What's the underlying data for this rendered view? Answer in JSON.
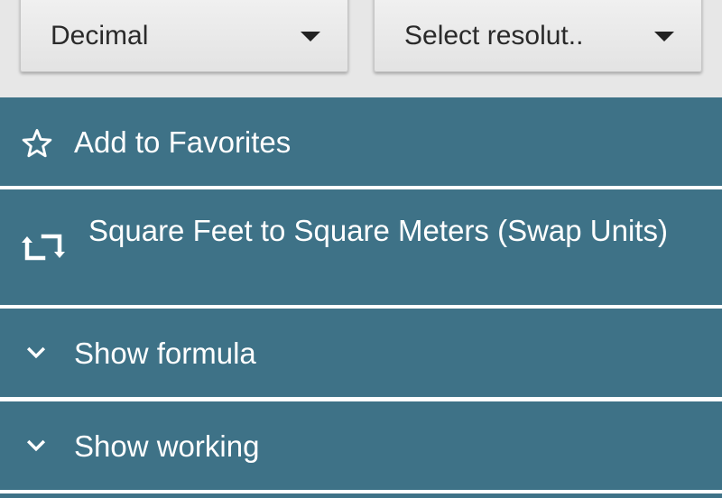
{
  "dropdowns": {
    "format": {
      "selected": "Decimal"
    },
    "resolution": {
      "selected": "Select resolut.."
    }
  },
  "menu": {
    "favorites": {
      "label": "Add to Favorites",
      "icon": "star-outline-icon"
    },
    "swap": {
      "label": "Square Feet to Square Meters (Swap Units)",
      "icon": "swap-repeat-icon"
    },
    "formula": {
      "label": "Show formula",
      "icon": "chevron-down-icon"
    },
    "working": {
      "label": "Show working",
      "icon": "chevron-down-icon"
    }
  },
  "colors": {
    "menu_background": "#3e7287",
    "menu_divider": "#ffffff",
    "dropdown_background": "#e9e9e9",
    "page_background": "#e7e7e7"
  }
}
